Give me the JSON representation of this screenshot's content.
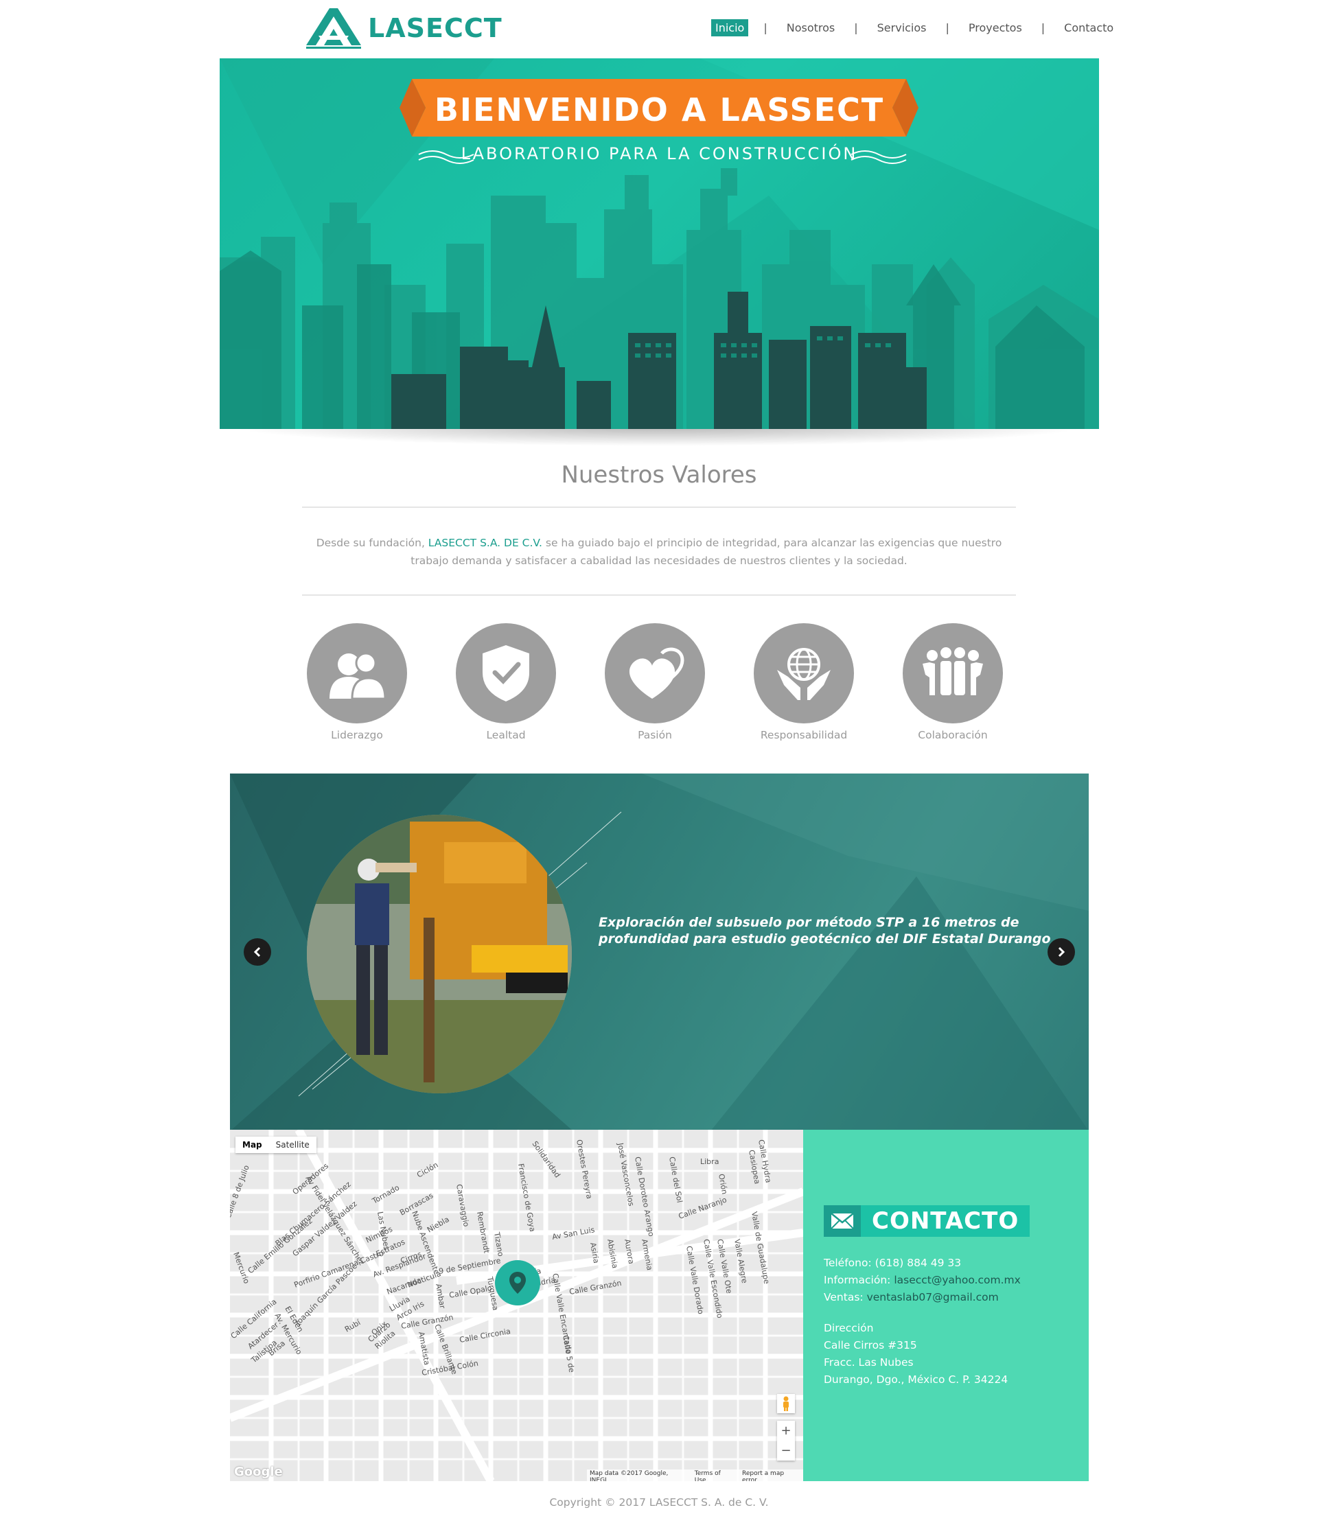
{
  "header": {
    "logo_text": "LASECCT",
    "nav": [
      {
        "label": "Inicio",
        "active": true
      },
      {
        "label": "Nosotros",
        "active": false
      },
      {
        "label": "Servicios",
        "active": false
      },
      {
        "label": "Proyectos",
        "active": false
      },
      {
        "label": "Contacto",
        "active": false
      }
    ],
    "nav_separator": "|"
  },
  "hero": {
    "title": "BIENVENIDO A LASSECT",
    "subtitle": "LABORATORIO PARA LA CONSTRUCCIÓN"
  },
  "values": {
    "title": "Nuestros Valores",
    "text_before": "Desde su fundación, ",
    "brand": "LASECCT S.A. DE C.V.",
    "text_after": " se ha guiado bajo el principio de integridad, para alcanzar las exigencias que nuestro trabajo demanda y satisfacer a cabalidad las necesidades de nuestros clientes y la sociedad.",
    "items": [
      {
        "label": "Liderazgo",
        "icon": "people-icon"
      },
      {
        "label": "Lealtad",
        "icon": "shield-check-icon"
      },
      {
        "label": "Pasión",
        "icon": "hearts-icon"
      },
      {
        "label": "Responsabilidad",
        "icon": "globe-hands-icon"
      },
      {
        "label": "Colaboración",
        "icon": "team-icon"
      }
    ]
  },
  "slider": {
    "caption": "Exploración del subsuelo por método STP a 16 metros de profundidad para estudio geotécnico del DIF Estatal Durango",
    "prev_icon": "chevron-left-icon",
    "next_icon": "chevron-right-icon"
  },
  "map": {
    "tabs": [
      {
        "label": "Map",
        "active": true
      },
      {
        "label": "Satellite",
        "active": false
      }
    ],
    "zoom_in": "+",
    "zoom_out": "−",
    "google": "Google",
    "attribution": [
      "Map data ©2017 Google, INEGI",
      "Terms of Use",
      "Report a map error"
    ],
    "streets": [
      "Av Fidel Velázquez Sánchez",
      "Operadores",
      "Ciclón",
      "Tornado",
      "Borrascas",
      "Niebla",
      "Las Nubes",
      "Nube Ascendente",
      "Caravaggio",
      "Rembrandt",
      "Tizano",
      "Solidaridad",
      "Francisco de Goya",
      "Orestes Pereyra",
      "José Vasconcelos",
      "Calle Doroteo Arango",
      "Calle del Sol",
      "Libra",
      "Orión",
      "Calle Hydra",
      "Casiopea",
      "Calle Naranjo",
      "Valle de Guadalupe",
      "Av San Luis",
      "Asiria",
      "Abisinia",
      "Aurora",
      "Armenia",
      "Calle Valle Escondido",
      "Calle Valle Dorado",
      "Calle Valle Ote",
      "Valle Alegre",
      "Blas Chumacero Sánchez",
      "Gaspar Valdez Valdez",
      "Calle Emilio González",
      "Nimbos",
      "Estratos",
      "Av. Resplandor",
      "Cirros",
      "Nacarada",
      "Nocticula",
      "9 de Septiembre",
      "Porfirio Camarena Castro",
      "Lluvia",
      "Arco Iris",
      "Ambar",
      "Calle Opalo",
      "Turquesa",
      "Asería",
      "Alejandría",
      "Calle Valle Encantado",
      "Calle Granzón",
      "Joaquín García Pascoe",
      "Onix",
      "Cuarzo",
      "Riolita",
      "Rubí",
      "Calle Granzón",
      "Calle Brillante",
      "Amatista",
      "Calle Circonia",
      "Cristóbal Colón",
      "Calle California",
      "Atardecer",
      "El Edén",
      "Av. Mercurio",
      "Talistipa",
      "Brisa",
      "Calle 8 de Julio",
      "Mercurio",
      "Calle 5 de"
    ]
  },
  "contact": {
    "title": "CONTACTO",
    "phone_label": "Teléfono:",
    "phone": "(618) 884 49 33",
    "info_label": "Información:",
    "info": "lasecct@yahoo.com.mx",
    "sales_label": "Ventas:",
    "sales": "ventaslab07@gmail.com",
    "address_label": "Dirección",
    "address_1": "Calle Cirros #315",
    "address_2": "Fracc. Las Nubes",
    "address_3": "Durango, Dgo., México C. P. 34224"
  },
  "footer": {
    "copyright": "Copyright © 2017 LASECCT S. A. de C. V."
  },
  "colors": {
    "brand": "#1b9e8e",
    "hero_bg": "#1cc2a6",
    "ribbon": "#f57f20",
    "slider_bg": "#2f7c77",
    "contact_bg": "#4fd9b3",
    "icon_gray": "#9e9e9e"
  }
}
